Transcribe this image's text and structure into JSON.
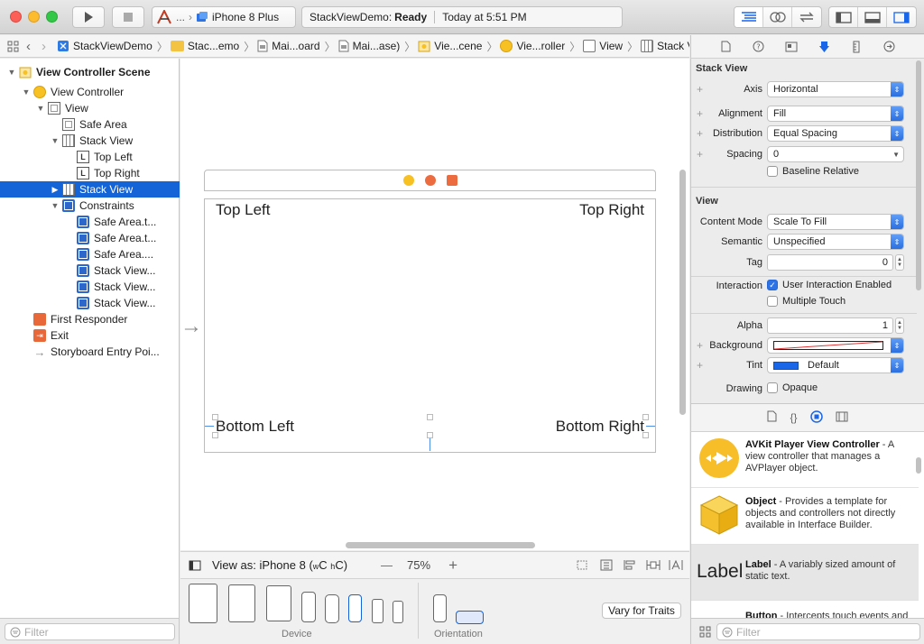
{
  "toolbar": {
    "scheme_target": "...",
    "scheme_device": "iPhone 8 Plus",
    "status_project": "StackViewDemo:",
    "status_state": "Ready",
    "status_time": "Today at 5:51 PM"
  },
  "jumpbar": {
    "items": [
      "StackViewDemo",
      "Stac...emo",
      "Mai...oard",
      "Mai...ase)",
      "Vie...cene",
      "Vie...roller",
      "View",
      "Stack View"
    ]
  },
  "navigator": {
    "items": [
      {
        "label": "View Controller Scene"
      },
      {
        "label": "View Controller"
      },
      {
        "label": "View"
      },
      {
        "label": "Safe Area"
      },
      {
        "label": "Stack View"
      },
      {
        "label": "Top Left"
      },
      {
        "label": "Top Right"
      },
      {
        "label": "Stack View"
      },
      {
        "label": "Constraints"
      },
      {
        "label": "Safe Area.t..."
      },
      {
        "label": "Safe Area.t..."
      },
      {
        "label": "Safe Area...."
      },
      {
        "label": "Stack View..."
      },
      {
        "label": "Stack View..."
      },
      {
        "label": "Stack View..."
      },
      {
        "label": "First Responder"
      },
      {
        "label": "Exit"
      },
      {
        "label": "Storyboard Entry Poi..."
      }
    ],
    "filter_placeholder": "Filter",
    "label_glyph": "L"
  },
  "canvas": {
    "top_left": "Top Left",
    "top_right": "Top Right",
    "bottom_left": "Bottom Left",
    "bottom_right": "Bottom Right",
    "entry_arrow": "→"
  },
  "viewas": {
    "prefix": "View as: iPhone 8 (",
    "w": "w",
    "wv": "C",
    "h": "h",
    "hv": "C",
    "suffix": ")",
    "minus": "—",
    "zoom": "75%",
    "plus": "+"
  },
  "devicebar": {
    "device_caption": "Device",
    "orientation_caption": "Orientation",
    "vary_button": "Vary for Traits"
  },
  "inspector": {
    "stack_section": "Stack View",
    "axis_label": "Axis",
    "axis_value": "Horizontal",
    "alignment_label": "Alignment",
    "alignment_value": "Fill",
    "distribution_label": "Distribution",
    "distribution_value": "Equal Spacing",
    "spacing_label": "Spacing",
    "spacing_value": "0",
    "baseline_label": "Baseline Relative",
    "view_section": "View",
    "content_mode_label": "Content Mode",
    "content_mode_value": "Scale To Fill",
    "semantic_label": "Semantic",
    "semantic_value": "Unspecified",
    "tag_label": "Tag",
    "tag_value": "0",
    "interaction_label": "Interaction",
    "user_interaction_label": "User Interaction Enabled",
    "multiple_touch_label": "Multiple Touch",
    "alpha_label": "Alpha",
    "alpha_value": "1",
    "background_label": "Background",
    "tint_label": "Tint",
    "tint_value": "Default",
    "drawing_label": "Drawing",
    "opaque_label": "Opaque",
    "plus_glyph": "+"
  },
  "library": {
    "items": [
      {
        "title": "AVKit Player View Controller",
        "desc": " - A view controller that manages a AVPlayer object."
      },
      {
        "title": "Object",
        "desc": " - Provides a template for objects and controllers not directly available in Interface Builder."
      },
      {
        "title": "Label",
        "desc": " - A variably sized amount of static text."
      },
      {
        "title": "Button",
        "desc": " - Intercepts touch events and"
      }
    ],
    "label_preview": "Label",
    "filter_placeholder": "Filter"
  },
  "colors": {
    "selection": "#1463d7",
    "tint": "#1a66e8"
  }
}
